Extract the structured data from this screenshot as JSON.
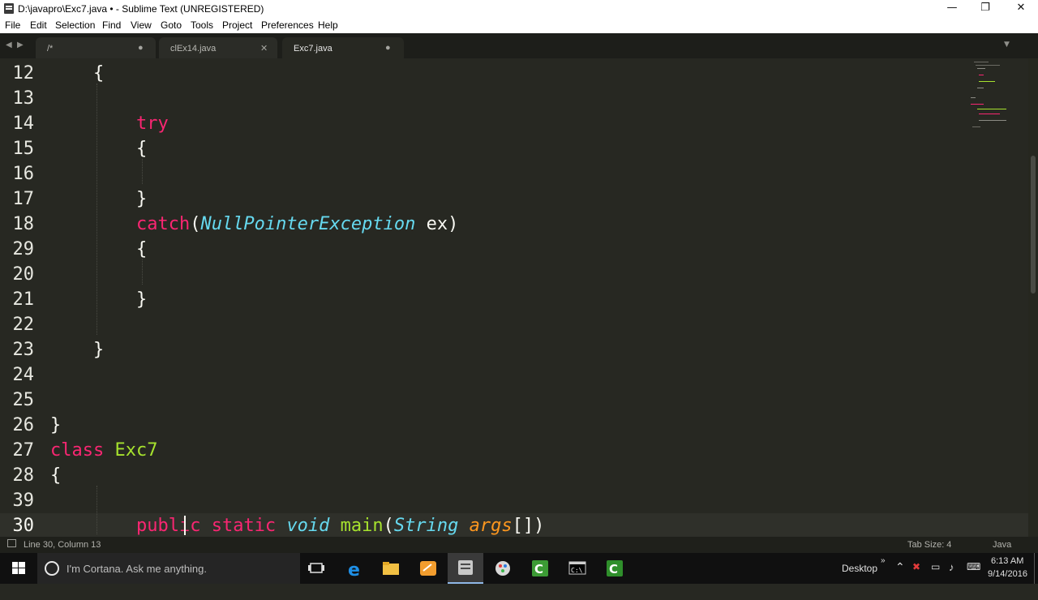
{
  "window": {
    "title": "D:\\javapro\\Exc7.java • - Sublime Text (UNREGISTERED)",
    "minimize": "—",
    "maximize": "❐",
    "close": "✕"
  },
  "menu": [
    "File",
    "Edit",
    "Selection",
    "Find",
    "View",
    "Goto",
    "Tools",
    "Project",
    "Preferences",
    "Help"
  ],
  "tabs": [
    {
      "label": "/*",
      "status": "●"
    },
    {
      "label": "clEx14.java",
      "status": "✕"
    },
    {
      "label": "Exc7.java",
      "status": "●"
    }
  ],
  "editor": {
    "line_numbers": [
      "12",
      "13",
      "14",
      "15",
      "16",
      "17",
      "18",
      "29",
      "20",
      "21",
      "22",
      "23",
      "24",
      "25",
      "26",
      "27",
      "28",
      "39",
      "30"
    ],
    "current_line": "30",
    "code": {
      "l12_brace": "{",
      "l14_try": "try",
      "l15_brace": "{",
      "l17_brace": "}",
      "l18_catch": "catch",
      "l18_open": "(",
      "l18_type": "NullPointerException",
      "l18_rest": " ex)",
      "l29_brace": "{",
      "l21_brace": "}",
      "l23_brace": "}",
      "l26_brace": "}",
      "l27_class": "class",
      "l27_name": "Exc7",
      "l28_brace": "{",
      "l30_public": "public",
      "l30_static": "static",
      "l30_void": "void",
      "l30_main": "main",
      "l30_open": "(",
      "l30_string": "String",
      "l30_args": "args",
      "l30_rest": "[])"
    }
  },
  "status": {
    "position": "Line 30, Column 13",
    "tab_size": "Tab Size: 4",
    "syntax": "Java"
  },
  "taskbar": {
    "cortana_placeholder": "I'm Cortana. Ask me anything.",
    "desktop_label": "Desktop",
    "time": "6:13 AM",
    "date": "9/14/2016"
  }
}
